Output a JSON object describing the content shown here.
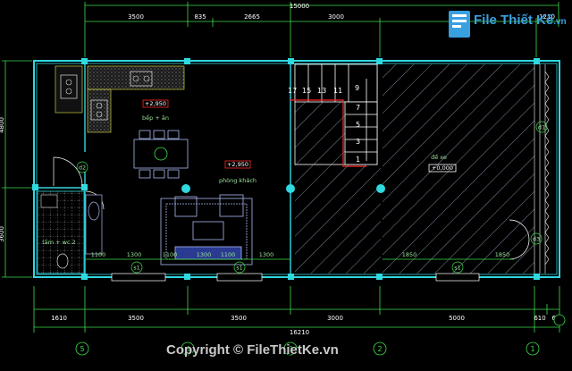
{
  "watermark": {
    "logo_name": "File Thiết Kế",
    "logo_ext": ".vn",
    "copyright": "Copyright © FileThietKe.vn"
  },
  "dims_top": {
    "overall": "15000",
    "segments": [
      "3500",
      "835",
      "2665",
      "3000",
      "1210"
    ]
  },
  "dims_bottom": {
    "overall": "16210",
    "segments": [
      "1610",
      "3500",
      "3500",
      "3000",
      "5000",
      "610",
      "600"
    ]
  },
  "dims_inner": {
    "left_group": [
      "1100",
      "1300",
      "1100",
      "1300",
      "1100",
      "1300"
    ],
    "right_group": [
      "1850",
      "1850"
    ]
  },
  "dims_left": [
    "4800",
    "3600"
  ],
  "rooms": {
    "kitchen": "bếp + ăn",
    "living": "phòng khách",
    "wc": "tắm + wc 2",
    "parking": "để xe"
  },
  "levels": {
    "kitchen": "+2,950",
    "living": "+2,950",
    "parking": "+0,000"
  },
  "stair_numbers": [
    "17",
    "15",
    "13",
    "11",
    "9",
    "7",
    "5",
    "3",
    "1"
  ],
  "axes_bottom": [
    "5",
    "4",
    "3",
    "2",
    "1"
  ],
  "axes_right": [
    "d1"
  ],
  "door_tags": [
    "d2",
    "d3",
    "s1",
    "s1",
    "s1"
  ],
  "colors": {
    "wall": "#30d8e0",
    "dim_line": "#3ddc4b",
    "text": "#ffffff",
    "hatch": "#7a8aa0",
    "furniture": "#a9b8f0",
    "level_red": "#ff2a2a",
    "logo": "#39a0e0"
  }
}
